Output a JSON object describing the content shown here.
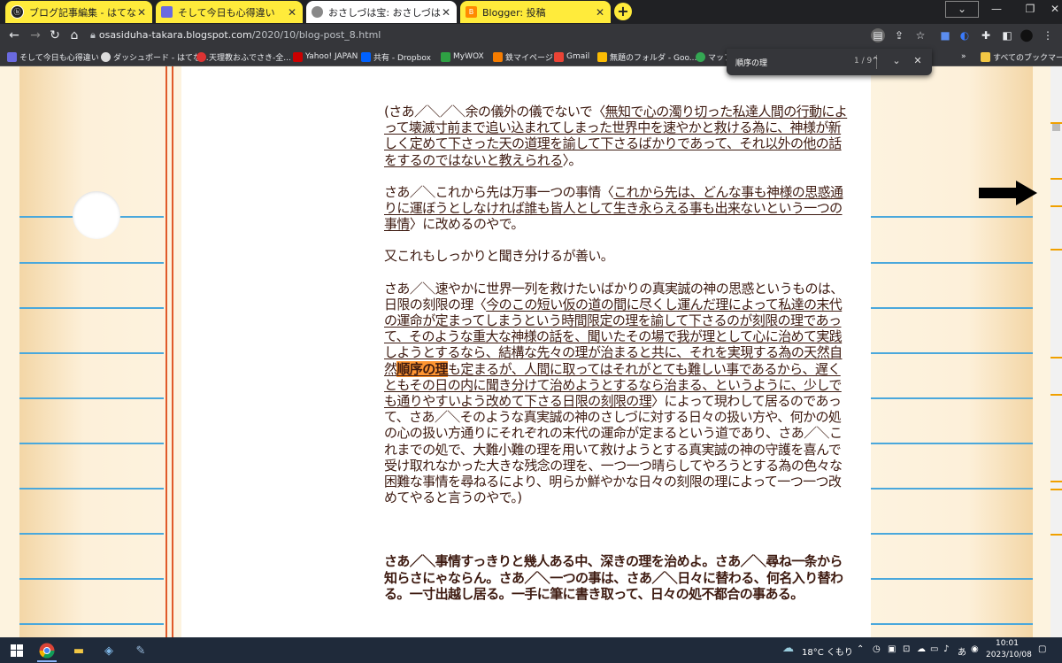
{
  "tabs": [
    {
      "title": "ブログ記事編集 - はてなブログ",
      "active": false
    },
    {
      "title": "そして今日も心得違い",
      "active": false
    },
    {
      "title": "おさしづは宝: おさしづは宝　刻限",
      "active": true
    },
    {
      "title": "Blogger: 投稿",
      "active": false
    }
  ],
  "toolbar": {
    "url_host": "osasiduha-takara.blogspot.com",
    "url_path": "/2020/10/blog-post_8.html"
  },
  "bookmarks": [
    "そして今日も心得違い",
    "ダッシュボード - はてな...",
    "天理教おふでさき-全...",
    "Yahoo! JAPAN",
    "共有 - Dropbox",
    "MyWOX",
    "鉄マイページ",
    "Gmail",
    "無題のフォルダ - Goo...",
    "マップ",
    "»",
    "すべてのブックマーク"
  ],
  "find": {
    "query": "順序の理",
    "count": "1 / 9"
  },
  "article": {
    "p1_a": "(さあ／＼／＼余の儀外の儀でないで〈",
    "p1_u": "無知で心の濁り切った私達人間の行動によって壊滅寸前まで追い込まれてしまった世界中を速やかと救ける為に、神様が新しく定めて下さった天の道理を諭して下さるばかりであって、それ以外の他の話をするのではないと教えられる",
    "p1_b": "〉。",
    "p2_a": "さあ／＼これから先は万事一つの事情〈",
    "p2_u": "これから先は、どんな事も神様の思惑通りに運ぼうとしなければ誰も皆人として生き永らえる事も出来ないという一つの事情",
    "p2_b": "〉に改めるのやで。",
    "p3": "又これもしっかりと聞き分けるが善い。",
    "p4_a": "さあ／＼速やかに世界一列を救けたいばかりの真実誠の神の思惑というものは、日限の刻限の理〈",
    "p4_u1": "今のこの短い仮の道の間に尽くし運んだ理によって私達の末代の運命が定まってしまうという時間限定の理を諭して下さるのが刻限の理であって、そのような重大な神様の話を、聞いたその場で我が理として心に治めて実践しようとするなら、結構な先々の理が治まると共に、それを実現する為の天然自然",
    "p4_hl": "順序の理",
    "p4_u2": "も定まるが、人間に取ってはそれがとても難しい事であるから、遅くともその日の内に聞き分けて治めようとするなら治まる、というように、少しでも通りやすいよう改めて下さる日限の刻限の理",
    "p4_b": "〉によって現わして居るのであって、さあ／＼そのような真実誠の神のさしづに対する日々の扱い方や、何かの処の心の扱い方通りにそれぞれの末代の運命が定まるという道であり、さあ／＼これまでの処で、大難小難の理を用いて救けようとする真実誠の神の守護を喜んで受け取れなかった大きな残念の理を、一つ一つ晴らしてやろうとする為の色々な困難な事情を尋ねるにより、明らか鮮やかな日々の刻限の理によって一つ一つ改めてやると言うのやで。)",
    "p5": "さあ／＼事情すっきりと幾人ある中、深きの理を治めよ。さあ／＼尋ね一条から知らさにゃならん。さあ／＼一つの事は、さあ／＼日々に替わる、何名入り替わる。一寸出越し居る。一手に筆に書き取って、日々の処不都合の事ある。"
  },
  "taskbar": {
    "weather": "18°C くもり",
    "time": "10:01",
    "date": "2023/10/08",
    "ime": "あ"
  }
}
